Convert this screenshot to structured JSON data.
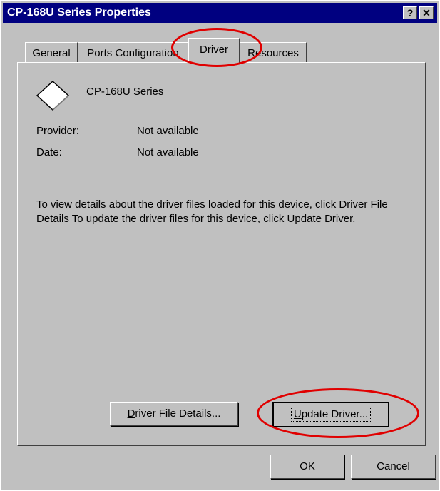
{
  "window": {
    "title": "CP-168U Series Properties",
    "help_glyph": "?",
    "close_glyph": "✕"
  },
  "tabs": [
    {
      "label": "General"
    },
    {
      "label": "Ports Configuration"
    },
    {
      "label": "Driver",
      "active": true
    },
    {
      "label": "Resources"
    }
  ],
  "driver": {
    "device_name": "CP-168U Series",
    "provider_label": "Provider:",
    "provider_value": "Not available",
    "date_label": "Date:",
    "date_value": "Not available",
    "description": "To view details about the driver files loaded for this device, click Driver File Details  To update the driver files for this device, click Update Driver.",
    "file_details_prefix": "D",
    "file_details_rest": "river File Details...",
    "update_prefix": "U",
    "update_rest": "pdate Driver..."
  },
  "footer": {
    "ok_label": "OK",
    "cancel_label": "Cancel"
  },
  "annotation_color": "#e00000"
}
